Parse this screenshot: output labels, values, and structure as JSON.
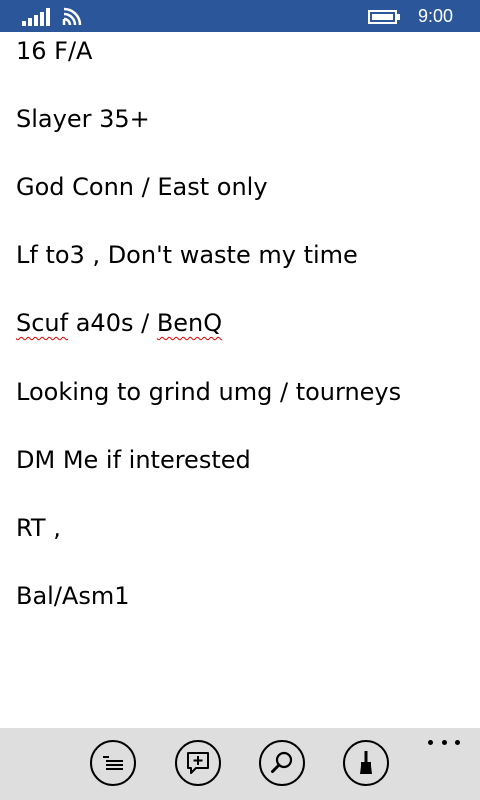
{
  "status_bar": {
    "time": "9:00",
    "background_color": "#2b579a",
    "icons": [
      "signal-strength-icon",
      "wifi-icon",
      "battery-icon"
    ]
  },
  "note": {
    "lines": [
      "16 F/A",
      "Slayer 35+",
      "God Conn / East only",
      "Lf to3 , Don't waste my time",
      "Looking to grind umg / tourneys",
      "DM Me if interested",
      "RT ,",
      "Bal/Asm1"
    ],
    "misspelled_line": {
      "word_1": "Scuf",
      "middle": " a40s / ",
      "word_2": "BenQ"
    }
  },
  "app_bar": {
    "background_color": "#dedede",
    "buttons": [
      "list-icon",
      "comment-add-icon",
      "search-icon",
      "brush-icon"
    ],
    "more_icon": "more-ellipsis-icon"
  }
}
